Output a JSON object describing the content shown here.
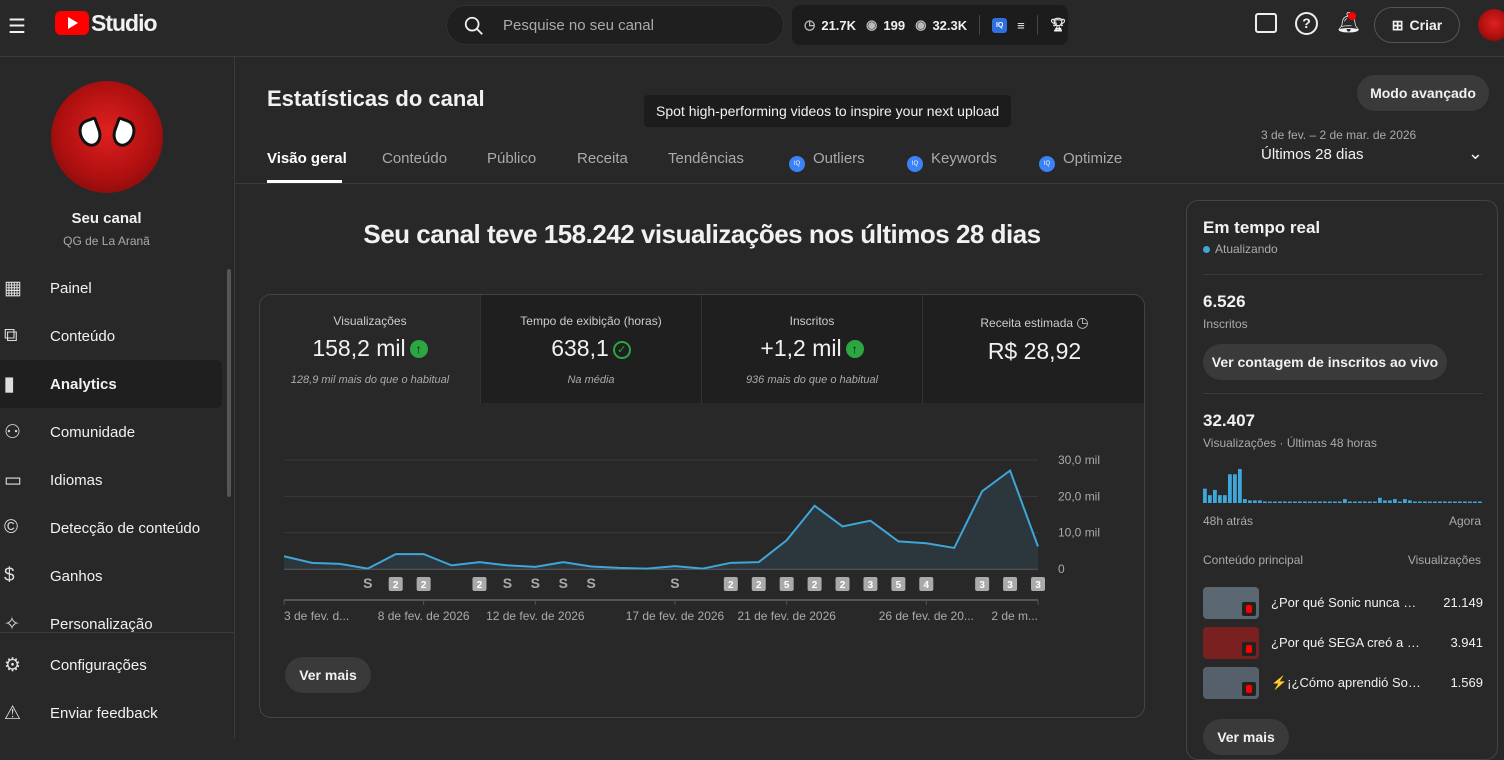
{
  "header": {
    "logo": "Studio",
    "search_placeholder": "Pesquise no seu canal",
    "ext_stats": [
      {
        "icon": "clock",
        "value": "21.7K"
      },
      {
        "icon": "eye",
        "value": "199"
      },
      {
        "icon": "eye",
        "value": "32.3K"
      }
    ],
    "ext_badge": "IQ",
    "create_label": "Criar"
  },
  "sidebar": {
    "channel_name": "Seu canal",
    "channel_handle": "QG de La Aranã",
    "items": [
      {
        "label": "Painel",
        "icon": "dashboard-icon"
      },
      {
        "label": "Conteúdo",
        "icon": "content-icon"
      },
      {
        "label": "Analytics",
        "icon": "analytics-icon"
      },
      {
        "label": "Comunidade",
        "icon": "community-icon"
      },
      {
        "label": "Idiomas",
        "icon": "subtitles-icon"
      },
      {
        "label": "Detecção de conteúdo",
        "icon": "copyright-icon"
      },
      {
        "label": "Ganhos",
        "icon": "money-icon"
      },
      {
        "label": "Personalização",
        "icon": "magic-icon"
      }
    ],
    "bottom": [
      {
        "label": "Configurações"
      },
      {
        "label": "Enviar feedback"
      }
    ]
  },
  "page": {
    "title": "Estatísticas do canal",
    "advanced_mode": "Modo avançado",
    "tooltip": "Spot high-performing videos to inspire your next upload",
    "date_range": "3 de fev. – 2 de mar. de 2026",
    "period": "Últimos 28 dias",
    "tabs": [
      {
        "label": "Visão geral"
      },
      {
        "label": "Conteúdo"
      },
      {
        "label": "Público"
      },
      {
        "label": "Receita"
      },
      {
        "label": "Tendências"
      },
      {
        "label": "Outliers",
        "iq": true
      },
      {
        "label": "Keywords",
        "iq": true
      },
      {
        "label": "Optimize",
        "iq": true
      }
    ],
    "headline": "Seu canal teve 158.242 visualizações nos últimos 28 dias",
    "stats": [
      {
        "label": "Visualizações",
        "value": "158,2 mil",
        "sub": "128,9 mil mais do que o habitual",
        "status": "up"
      },
      {
        "label": "Tempo de exibição (horas)",
        "value": "638,1",
        "sub": "Na média",
        "status": "check"
      },
      {
        "label": "Inscritos",
        "value": "+1,2 mil",
        "sub": "936 mais do que o habitual",
        "status": "up"
      },
      {
        "label": "Receita estimada",
        "value": "R$ 28,92",
        "sub": "",
        "status": "clock"
      }
    ],
    "see_more": "Ver mais"
  },
  "chart_data": {
    "type": "area",
    "series": [
      {
        "name": "Visualizações",
        "values": [
          3.5,
          1.7,
          1.4,
          0.1,
          4.1,
          4.1,
          1.0,
          1.9,
          1.0,
          0.6,
          1.9,
          0.7,
          0.3,
          0.1,
          0.8,
          0.1,
          1.7,
          1.9,
          7.9,
          17.4,
          11.7,
          13.3,
          7.6,
          7.1,
          5.8,
          21.4,
          27.1,
          6.2
        ]
      }
    ],
    "unit": "mil",
    "ylim": [
      0,
      30
    ],
    "yticks": [
      "0",
      "10,0 mil",
      "20,0 mil",
      "30,0 mil"
    ],
    "xticks": [
      {
        "i": 0,
        "label": "3 de fev. d..."
      },
      {
        "i": 5,
        "label": "8 de fev. de 2026"
      },
      {
        "i": 9,
        "label": "12 de fev. de 2026"
      },
      {
        "i": 14,
        "label": "17 de fev. de 2026"
      },
      {
        "i": 18,
        "label": "21 de fev. de 2026"
      },
      {
        "i": 23,
        "label": "26 de fev. de 20..."
      },
      {
        "i": 27,
        "label": "2 de m..."
      }
    ],
    "markers": [
      {
        "i": 3,
        "label": "S"
      },
      {
        "i": 4,
        "label": "2"
      },
      {
        "i": 5,
        "label": "2"
      },
      {
        "i": 7,
        "label": "2"
      },
      {
        "i": 8,
        "label": "S"
      },
      {
        "i": 9,
        "label": "S"
      },
      {
        "i": 10,
        "label": "S"
      },
      {
        "i": 11,
        "label": "S"
      },
      {
        "i": 14,
        "label": "S"
      },
      {
        "i": 16,
        "label": "2"
      },
      {
        "i": 17,
        "label": "2"
      },
      {
        "i": 18,
        "label": "5"
      },
      {
        "i": 19,
        "label": "2"
      },
      {
        "i": 20,
        "label": "2"
      },
      {
        "i": 21,
        "label": "3"
      },
      {
        "i": 22,
        "label": "5"
      },
      {
        "i": 23,
        "label": "4"
      },
      {
        "i": 25,
        "label": "3"
      },
      {
        "i": 26,
        "label": "3"
      },
      {
        "i": 27,
        "label": "3"
      }
    ],
    "color": "#3ea6d8"
  },
  "realtime": {
    "title": "Em tempo real",
    "status": "Atualizando",
    "subs_value": "6.526",
    "subs_label": "Inscritos",
    "live_button": "Ver contagem de inscritos ao vivo",
    "views_value": "32.407",
    "views_label": "Visualizações · Últimas 48 horas",
    "bars": [
      11,
      6,
      10,
      6,
      6,
      22,
      22,
      26,
      3,
      2,
      2,
      2,
      1,
      1,
      0,
      0,
      0,
      0,
      0,
      0,
      0,
      0,
      0,
      0,
      0,
      0,
      0,
      0,
      3,
      1,
      1,
      1,
      1,
      1,
      1,
      4,
      2,
      2,
      3,
      1,
      3,
      2,
      1,
      0,
      0,
      0,
      0,
      0,
      0,
      1,
      0,
      0,
      0,
      0,
      0,
      0
    ],
    "start_label": "48h atrás",
    "end_label": "Agora",
    "top_header": "Conteúdo principal",
    "top_views_header": "Visualizações",
    "top": [
      {
        "title": "¿Por qué Sonic nunca e...",
        "views": "21.149",
        "thumb": "#5b6770"
      },
      {
        "title": "¿Por qué SEGA creó a So...",
        "views": "3.941",
        "thumb": "#7a2020"
      },
      {
        "title": "⚡¡¿Cómo aprendió Soni...",
        "views": "1.569",
        "thumb": "#55606a"
      }
    ],
    "see_more": "Ver mais"
  }
}
